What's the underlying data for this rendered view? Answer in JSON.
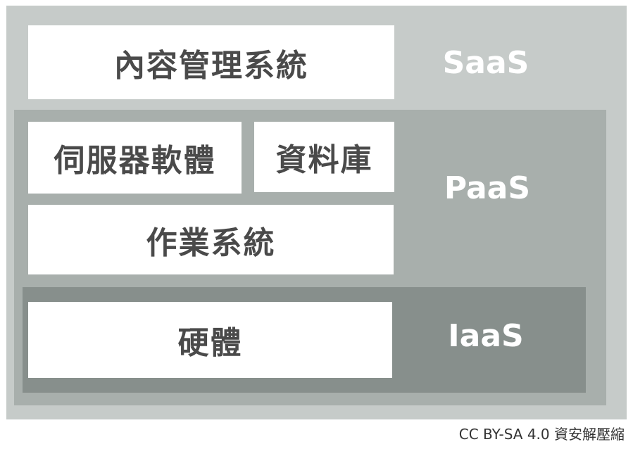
{
  "layers": {
    "saas": {
      "label": "SaaS",
      "color": "#c6cbc9",
      "boxes": [
        "內容管理系統"
      ]
    },
    "paas": {
      "label": "PaaS",
      "color": "#a8afac",
      "boxes": [
        "伺服器軟體",
        "資料庫",
        "作業系統"
      ]
    },
    "iaas": {
      "label": "IaaS",
      "color": "#878f8c",
      "boxes": [
        "硬體"
      ]
    }
  },
  "credit": "CC BY-SA 4.0  資安解壓縮"
}
